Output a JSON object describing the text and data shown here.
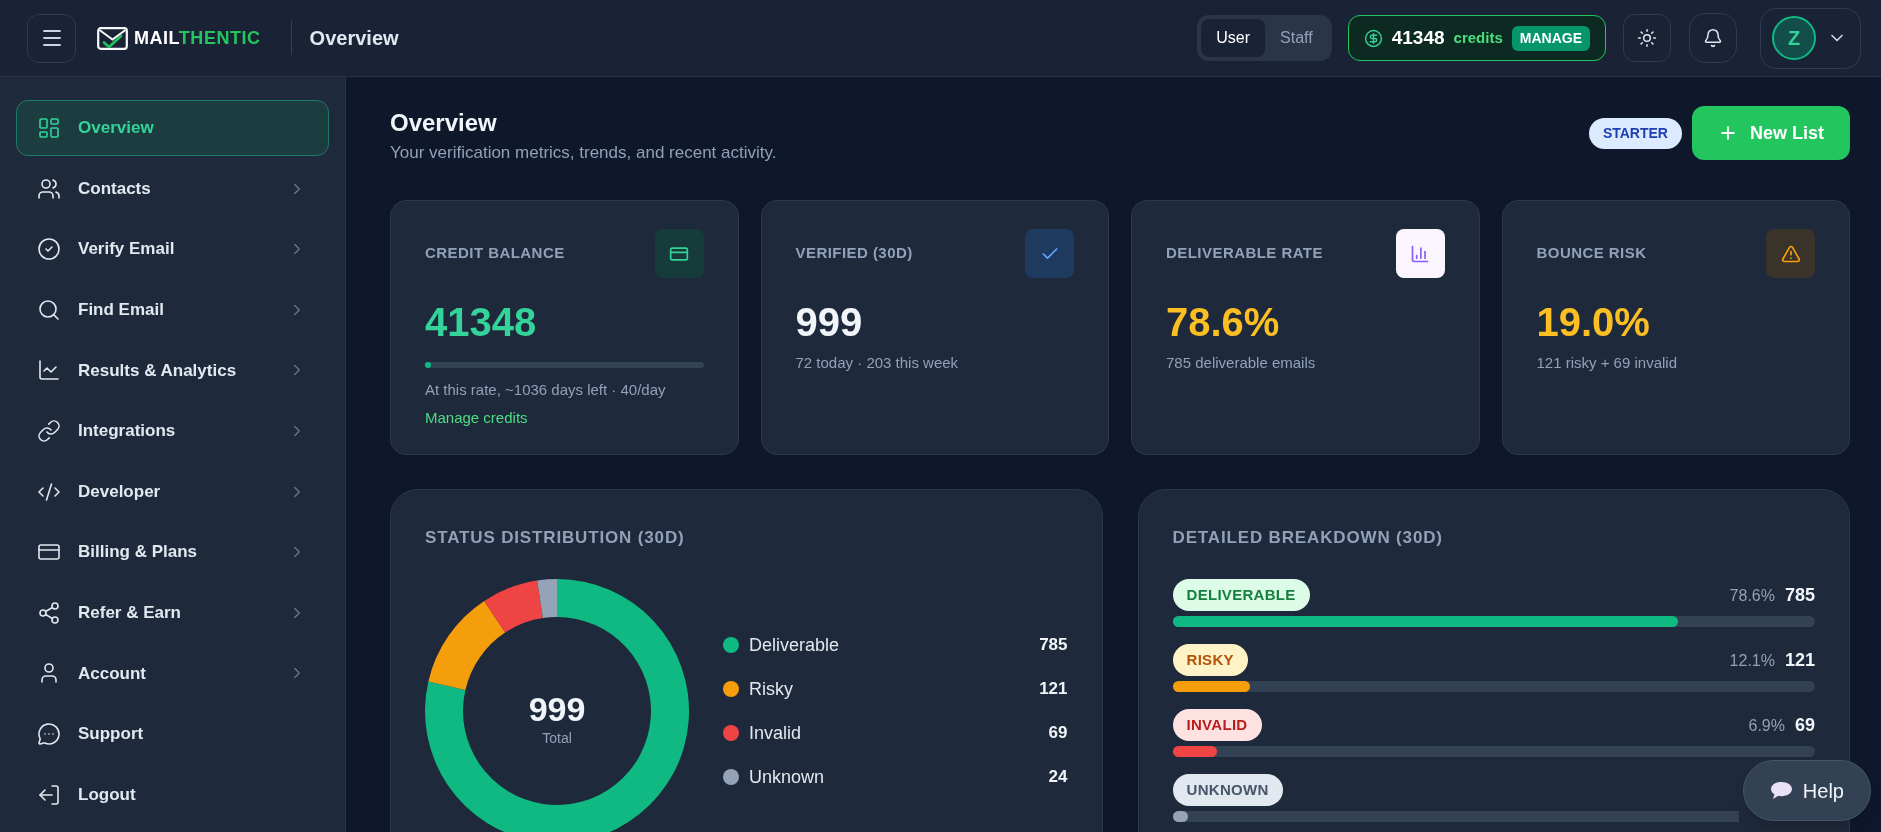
{
  "topbar": {
    "brand": {
      "primary": "MAIL",
      "accent": "THENTIC"
    },
    "title": "Overview",
    "view_tabs": [
      {
        "label": "User",
        "selected": true
      },
      {
        "label": "Staff",
        "selected": false
      }
    ],
    "credits": {
      "amount": "41348",
      "unit": "credits",
      "action": "MANAGE"
    },
    "avatar": {
      "initial": "Z"
    }
  },
  "sidebar": {
    "items": [
      {
        "label": "Overview",
        "selected": true,
        "expandable": false
      },
      {
        "label": "Contacts",
        "selected": false,
        "expandable": true
      },
      {
        "label": "Verify Email",
        "selected": false,
        "expandable": true
      },
      {
        "label": "Find Email",
        "selected": false,
        "expandable": true
      },
      {
        "label": "Results & Analytics",
        "selected": false,
        "expandable": true
      },
      {
        "label": "Integrations",
        "selected": false,
        "expandable": true
      },
      {
        "label": "Developer",
        "selected": false,
        "expandable": true
      },
      {
        "label": "Billing & Plans",
        "selected": false,
        "expandable": true
      },
      {
        "label": "Refer & Earn",
        "selected": false,
        "expandable": true
      },
      {
        "label": "Account",
        "selected": false,
        "expandable": true
      },
      {
        "label": "Support",
        "selected": false,
        "expandable": false
      },
      {
        "label": "Logout",
        "selected": false,
        "expandable": false
      }
    ]
  },
  "page": {
    "title": "Overview",
    "subtitle": "Your verification metrics, trends, and recent activity.",
    "plan_badge": "STARTER",
    "primary_action": "New List"
  },
  "stat_cards": [
    {
      "label": "CREDIT BALANCE",
      "value": "41348",
      "level": 0.02,
      "note": "At this rate, ~1036 days left · 40/day",
      "link": "Manage credits"
    },
    {
      "label": "VERIFIED (30D)",
      "value": "999",
      "note": "72 today · 203 this week"
    },
    {
      "label": "DELIVERABLE RATE",
      "value": "78.6%",
      "note": "785 deliverable emails"
    },
    {
      "label": "BOUNCE RISK",
      "value": "19.0%",
      "note": "121 risky + 69 invalid"
    }
  ],
  "status_distribution": {
    "title": "STATUS DISTRIBUTION (30D)",
    "chart_data": {
      "type": "donut",
      "categories": [
        "Deliverable",
        "Risky",
        "Invalid",
        "Unknown"
      ],
      "values": [
        78.6,
        12.1,
        6.9,
        2.4
      ]
    },
    "center_value": "999",
    "center_label": "Total",
    "legend": [
      {
        "value": "785",
        "color": "#10b981"
      },
      {
        "value": "121",
        "color": "#f59e0b"
      },
      {
        "value": "69",
        "color": "#ef4444"
      },
      {
        "value": "24",
        "color": "#94a3b8"
      }
    ]
  },
  "breakdown": {
    "title": "DETAILED BREAKDOWN (30D)",
    "rows": [
      {
        "label": "DELIVERABLE",
        "percent": "78.6%",
        "count": "785",
        "level": 0.786,
        "color": "#10b981"
      },
      {
        "label": "RISKY",
        "percent": "12.1%",
        "count": "121",
        "level": 0.121,
        "color": "#f59e0b"
      },
      {
        "label": "INVALID",
        "percent": "6.9%",
        "count": "69",
        "level": 0.069,
        "color": "#ef4444"
      },
      {
        "label": "UNKNOWN",
        "level": 0.027,
        "color": "#94a3b8"
      }
    ]
  },
  "help_button": {
    "label": "Help"
  }
}
